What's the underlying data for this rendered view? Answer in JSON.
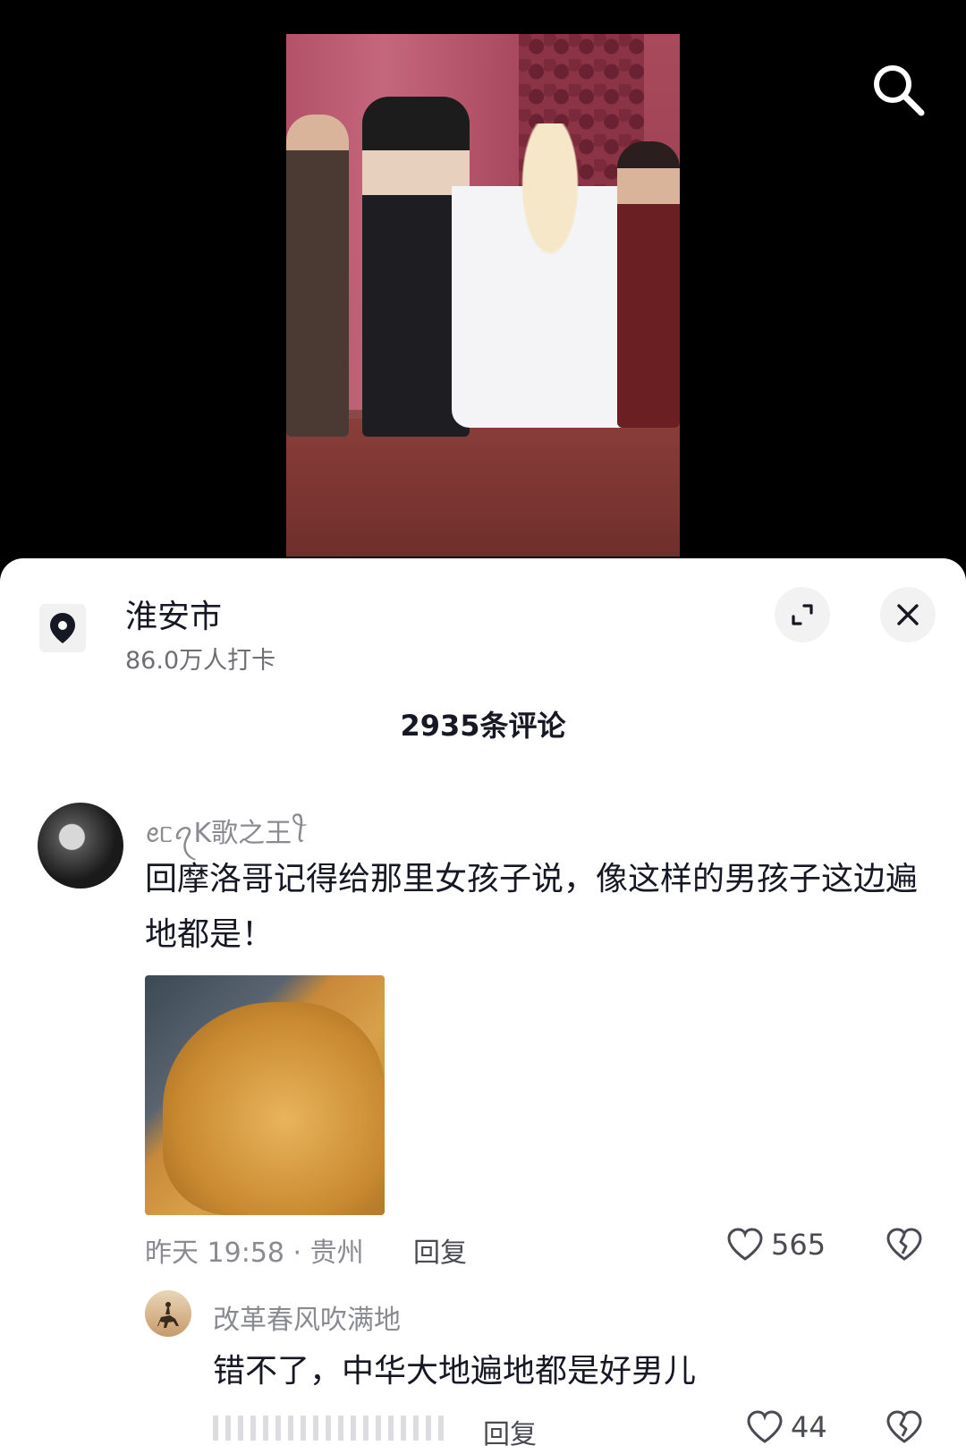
{
  "location": {
    "name": "淮安市",
    "checkins": "86.0万人打卡"
  },
  "comments_header": "2935条评论",
  "comments": [
    {
      "username": "ꫀᥴꪖK歌之王ꪻ",
      "text": "回摩洛哥记得给那里女孩子说，像这样的男孩子这边遍地都是！",
      "time": "昨天 19:58",
      "region": "贵州",
      "reply_label": "回复",
      "likes": "565"
    }
  ],
  "replies": [
    {
      "username": "改革春风吹满地",
      "text": "错不了，中华大地遍地都是好男儿",
      "reply_label": "回复",
      "likes": "44"
    }
  ],
  "colors": {
    "text_primary": "#161823",
    "text_secondary": "#8a8b91",
    "sheet_bg": "#ffffff"
  },
  "icons": [
    "search-icon",
    "location-pin-icon",
    "expand-icon",
    "close-icon",
    "heart-icon",
    "broken-heart-icon"
  ]
}
